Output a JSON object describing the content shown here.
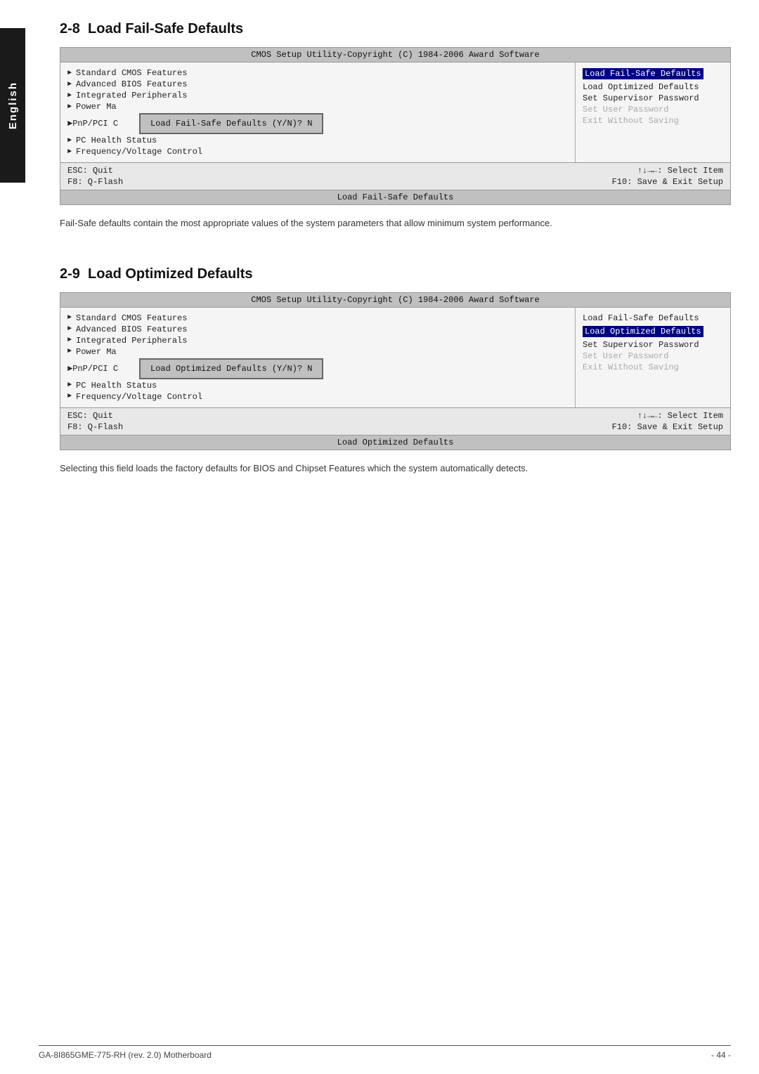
{
  "sidebar": {
    "label": "English"
  },
  "section1": {
    "number": "2-8",
    "title": "Load Fail-Safe Defaults",
    "bios": {
      "title": "CMOS Setup Utility-Copyright (C) 1984-2006 Award Software",
      "left_items": [
        "Standard CMOS Features",
        "Advanced BIOS Features",
        "Integrated Peripherals",
        "Power Ma",
        "PnP/PCI C",
        "PC Health Status",
        "Frequency/Voltage Control"
      ],
      "right_items": [
        {
          "text": "Load Fail-Safe Defaults",
          "highlighted": true
        },
        {
          "text": "Load Optimized Defaults",
          "highlighted": false
        },
        {
          "text": "Set Supervisor Password",
          "highlighted": false
        },
        {
          "text": "Set User Password (obscured)",
          "highlighted": false
        },
        {
          "text": "Exit Without Saving",
          "highlighted": false
        }
      ],
      "dialog": "Load Fail-Safe Defaults (Y/N)? N",
      "footer_left1": "ESC: Quit",
      "footer_left2": "F8: Q-Flash",
      "footer_right1": "↑↓→←: Select Item",
      "footer_right2": "F10: Save & Exit Setup",
      "status_bar": "Load Fail-Safe Defaults"
    },
    "description": "Fail-Safe defaults contain the most appropriate values of the system parameters that allow minimum system performance."
  },
  "section2": {
    "number": "2-9",
    "title": "Load Optimized Defaults",
    "bios": {
      "title": "CMOS Setup Utility-Copyright (C) 1984-2006 Award Software",
      "left_items": [
        "Standard CMOS Features",
        "Advanced BIOS Features",
        "Integrated Peripherals",
        "Power Ma",
        "PnP/PCI C",
        "PC Health Status",
        "Frequency/Voltage Control"
      ],
      "right_items": [
        {
          "text": "Load Fail-Safe Defaults",
          "highlighted": false
        },
        {
          "text": "Load Optimized Defaults",
          "highlighted": true
        },
        {
          "text": "Set Supervisor Password",
          "highlighted": false
        },
        {
          "text": "Set User Password (obscured)",
          "highlighted": false
        },
        {
          "text": "Exit Without Saving",
          "highlighted": false
        }
      ],
      "dialog": "Load Optimized Defaults (Y/N)? N",
      "footer_left1": "ESC: Quit",
      "footer_left2": "F8: Q-Flash",
      "footer_right1": "↑↓→←: Select Item",
      "footer_right2": "F10: Save & Exit Setup",
      "status_bar": "Load Optimized Defaults"
    },
    "description": "Selecting this field loads the factory defaults for BIOS and Chipset Features which the system automatically detects."
  },
  "footer": {
    "left": "GA-8I865GME-775-RH (rev. 2.0) Motherboard",
    "right": "- 44 -"
  }
}
